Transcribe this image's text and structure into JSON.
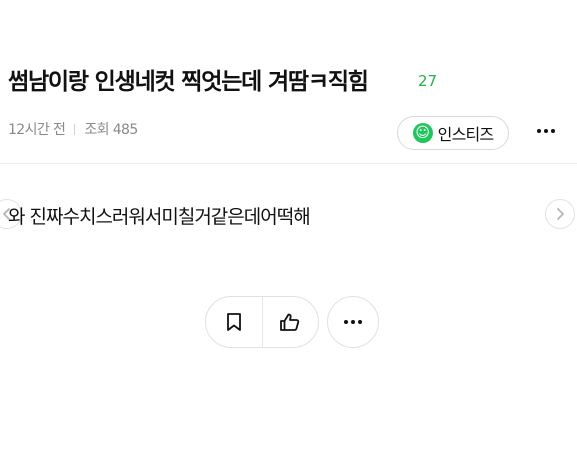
{
  "post": {
    "title": "썸남이랑 인생네컷 찍엇는데 겨땀ㅋ직힘",
    "comment_count": "27",
    "time_ago": "12시간 전",
    "views": "조회 485",
    "body": "와 진짜수치스러워서미칠거같은데어떡해"
  },
  "category": {
    "label": "인스티즈",
    "icon": "instiz-logo-icon",
    "color": "#22c55e"
  },
  "colors": {
    "comment_count": "#25b04b",
    "meta": "#8a8a8a"
  },
  "actions": {
    "bookmark_icon": "bookmark-icon",
    "like_icon": "thumbs-up-icon",
    "more_icon": "more-horizontal-icon"
  }
}
